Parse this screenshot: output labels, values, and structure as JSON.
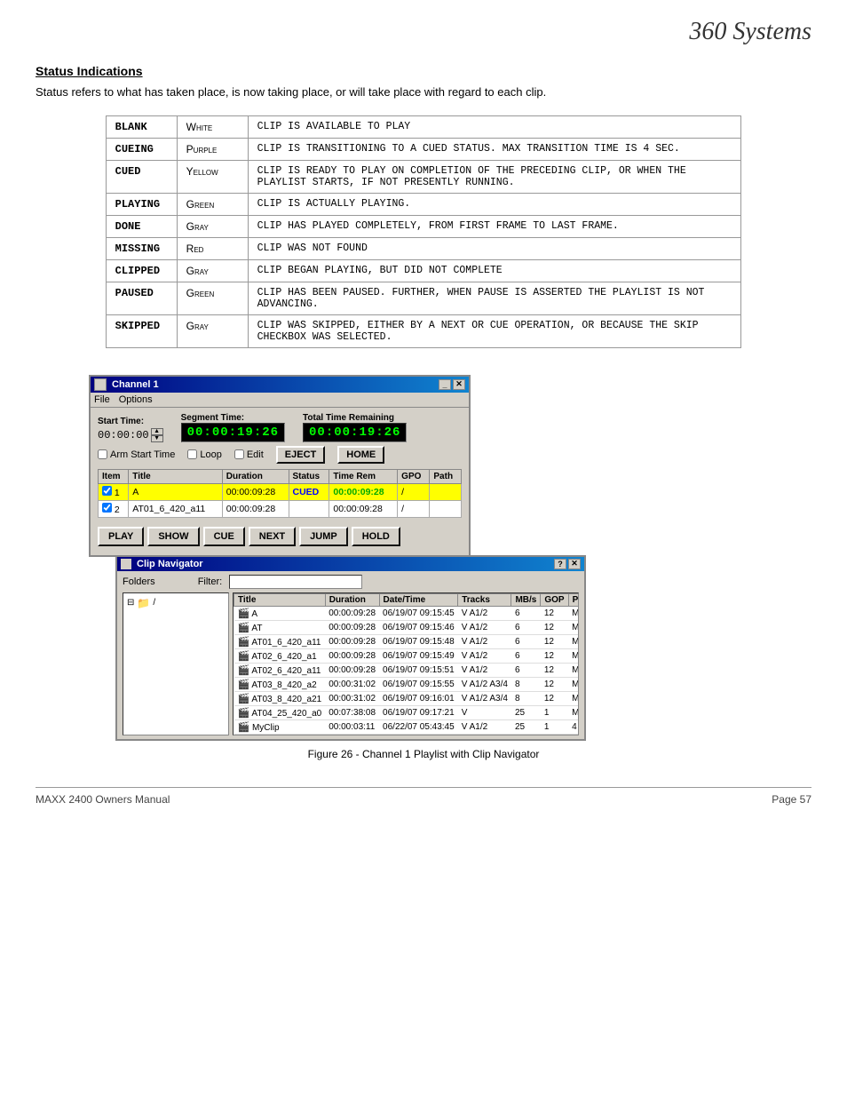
{
  "logo": "360 Systems",
  "section": {
    "title": "Status Indications",
    "description": "Status refers to what has taken place, is now taking place, or will take place with regard to each clip."
  },
  "statusTable": {
    "rows": [
      {
        "name": "BLANK",
        "color": "White",
        "description": "CLIP IS AVAILABLE TO PLAY"
      },
      {
        "name": "CUEING",
        "color": "Purple",
        "description": "CLIP IS TRANSITIONING TO A CUED STATUS. MAX TRANSITION TIME IS 4 SEC."
      },
      {
        "name": "CUED",
        "color": "Yellow",
        "description": "CLIP IS READY TO PLAY ON COMPLETION OF THE PRECEDING CLIP, OR WHEN THE PLAYLIST STARTS, IF NOT PRESENTLY RUNNING."
      },
      {
        "name": "PLAYING",
        "color": "Green",
        "description": "CLIP IS ACTUALLY PLAYING."
      },
      {
        "name": "DONE",
        "color": "Gray",
        "description": "CLIP HAS PLAYED COMPLETELY, FROM FIRST FRAME TO LAST FRAME."
      },
      {
        "name": "MISSING",
        "color": "Red",
        "description": "CLIP WAS NOT FOUND"
      },
      {
        "name": "CLIPPED",
        "color": "Gray",
        "description": "CLIP BEGAN PLAYING, BUT DID NOT COMPLETE"
      },
      {
        "name": "PAUSED",
        "color": "Green",
        "description": "CLIP HAS BEEN PAUSED. FURTHER, WHEN PAUSE IS ASSERTED THE PLAYLIST IS NOT ADVANCING."
      },
      {
        "name": "SKIPPED",
        "color": "Gray",
        "description": "CLIP WAS SKIPPED, EITHER BY A NEXT OR CUE OPERATION, OR BECAUSE THE SKIP CHECKBOX WAS SELECTED."
      }
    ]
  },
  "channelWindow": {
    "title": "Channel  1",
    "menu": [
      "File",
      "Options"
    ],
    "labels": {
      "startTime": "Start Time:",
      "segmentTime": "Segment Time:",
      "totalTimeRemaining": "Total Time Remaining",
      "armStartTime": "Arm Start Time",
      "loop": "Loop",
      "edit": "Edit"
    },
    "startTimeVal": "00:00:00",
    "segmentTime": "00:00:19:26",
    "totalTime": "00:00:19:26",
    "buttons": {
      "eject": "EJECT",
      "home": "HOME"
    },
    "columns": [
      "Item",
      "Title",
      "Duration",
      "Status",
      "Time Rem",
      "GPO",
      "Path"
    ],
    "rows": [
      {
        "item": "1",
        "checked": true,
        "title": "A",
        "duration": "00:00:09:28",
        "status": "CUED",
        "timeRem": "00:00:09:28",
        "gpo": "/",
        "path": "",
        "highlight": true
      },
      {
        "item": "2",
        "checked": true,
        "title": "AT01_6_420_a11",
        "duration": "00:00:09:28",
        "status": "",
        "timeRem": "00:00:09:28",
        "gpo": "/",
        "path": "",
        "highlight": false
      }
    ],
    "controls": [
      "PLAY",
      "SHOW",
      "CUE",
      "NEXT",
      "JUMP",
      "HOLD"
    ]
  },
  "clipNavigator": {
    "title": "Clip Navigator",
    "filterLabel": "Filter:",
    "filterValue": "",
    "foldersLabel": "Folders",
    "folderTree": "/ ",
    "columns": [
      "Title",
      "Duration",
      "Date/Time",
      "Tracks",
      "MB/s",
      "GOP",
      "P"
    ],
    "clips": [
      {
        "name": "A",
        "duration": "00:00:09:28",
        "datetime": "06/19/07 09:15:45",
        "tracks": "V A1/2",
        "mbs": "6",
        "gop": "12",
        "p": "M"
      },
      {
        "name": "AT",
        "duration": "00:00:09:28",
        "datetime": "06/19/07 09:15:46",
        "tracks": "V A1/2",
        "mbs": "6",
        "gop": "12",
        "p": "M"
      },
      {
        "name": "AT01_6_420_a11",
        "duration": "00:00:09:28",
        "datetime": "06/19/07 09:15:48",
        "tracks": "V A1/2",
        "mbs": "6",
        "gop": "12",
        "p": "M"
      },
      {
        "name": "AT02_6_420_a1",
        "duration": "00:00:09:28",
        "datetime": "06/19/07 09:15:49",
        "tracks": "V A1/2",
        "mbs": "6",
        "gop": "12",
        "p": "M"
      },
      {
        "name": "AT02_6_420_a11",
        "duration": "00:00:09:28",
        "datetime": "06/19/07 09:15:51",
        "tracks": "V A1/2",
        "mbs": "6",
        "gop": "12",
        "p": "M"
      },
      {
        "name": "AT03_8_420_a2",
        "duration": "00:00:31:02",
        "datetime": "06/19/07 09:15:55",
        "tracks": "V A1/2 A3/4",
        "mbs": "8",
        "gop": "12",
        "p": "M"
      },
      {
        "name": "AT03_8_420_a21",
        "duration": "00:00:31:02",
        "datetime": "06/19/07 09:16:01",
        "tracks": "V A1/2 A3/4",
        "mbs": "8",
        "gop": "12",
        "p": "M"
      },
      {
        "name": "AT04_25_420_a0",
        "duration": "00:07:38:08",
        "datetime": "06/19/07 09:17:21",
        "tracks": "V",
        "mbs": "25",
        "gop": "1",
        "p": "M"
      },
      {
        "name": "MyClip",
        "duration": "00:00:03:11",
        "datetime": "06/22/07 05:43:45",
        "tracks": "V A1/2",
        "mbs": "25",
        "gop": "1",
        "p": "4"
      }
    ]
  },
  "figureCaption": "Figure 26 - Channel 1 Playlist with Clip Navigator",
  "footer": {
    "left": "MAXX 2400 Owners Manual",
    "right": "Page 57"
  }
}
